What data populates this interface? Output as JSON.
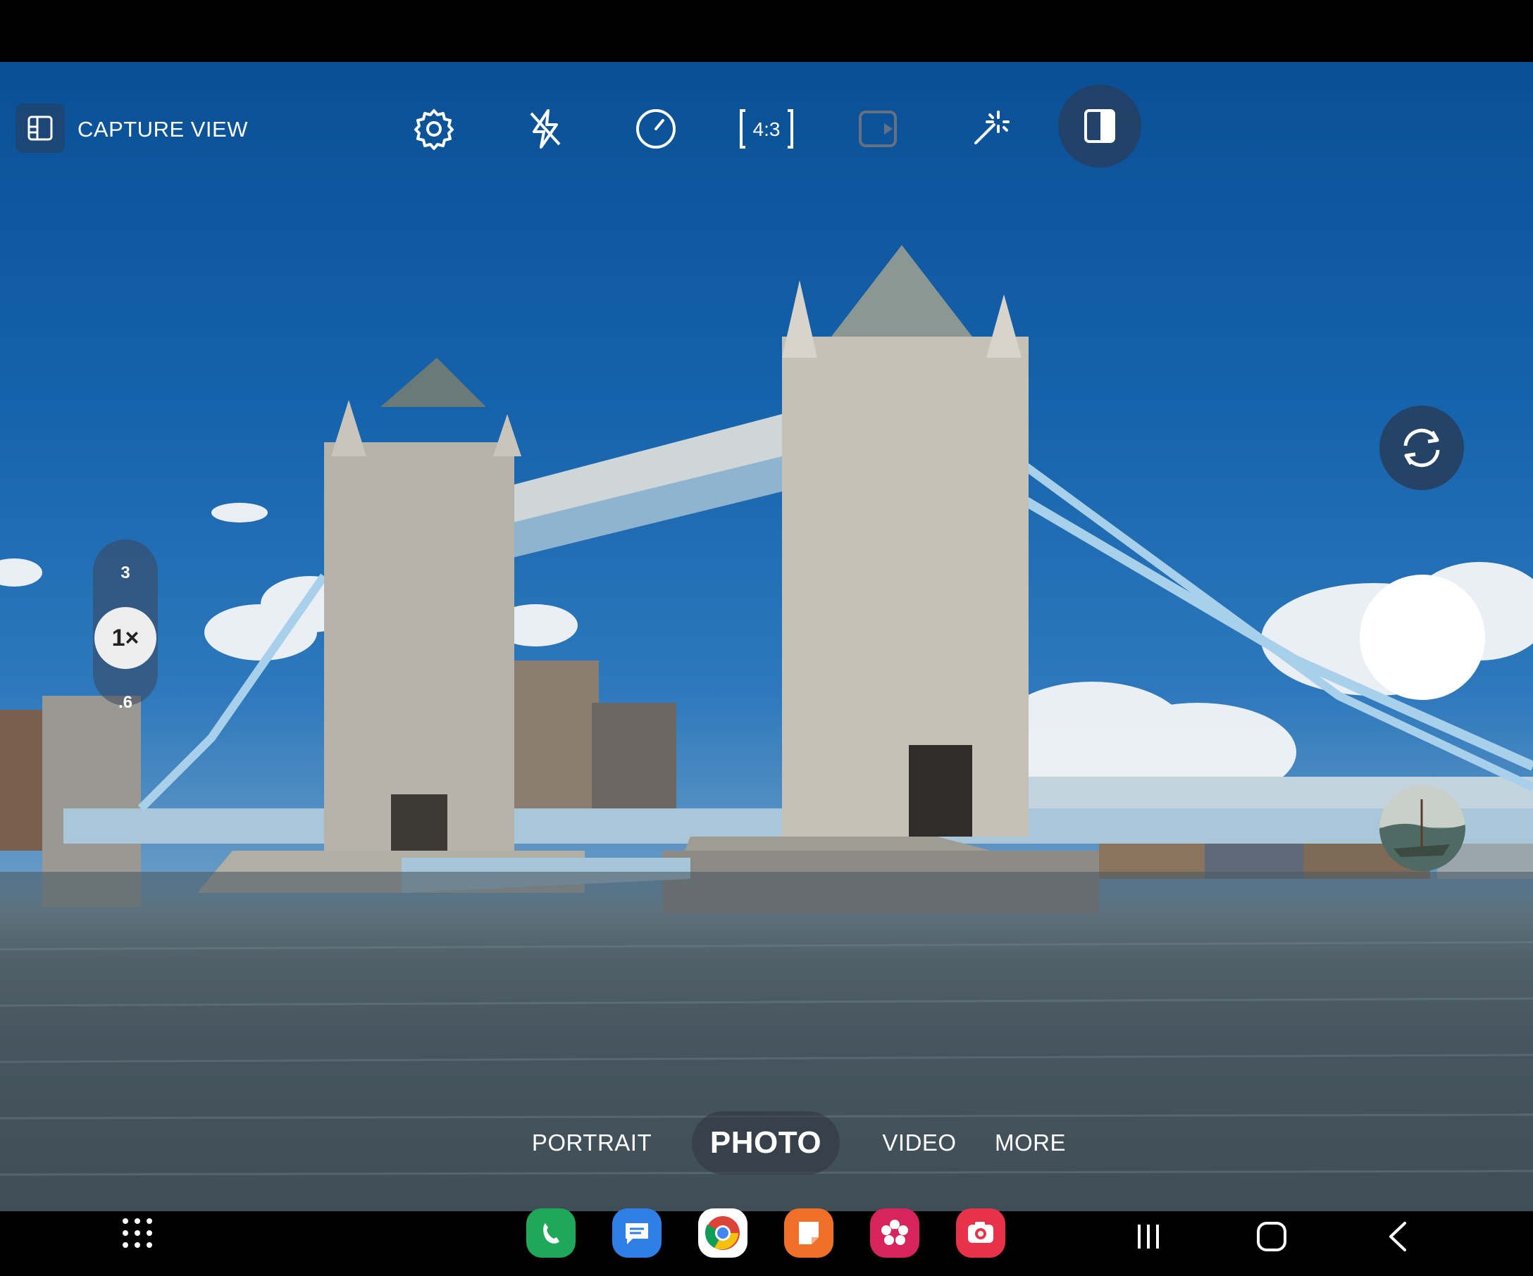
{
  "top_bar": {
    "capture_view_label": "CAPTURE VIEW",
    "icons": [
      "settings-icon",
      "flash-off-icon",
      "timer-icon",
      "aspect-ratio-icon",
      "motion-photo-icon",
      "filters-icon",
      "split-view-icon"
    ],
    "aspect_ratio_label": "4:3"
  },
  "zoom": {
    "level_3": "3",
    "level_1": "1×",
    "level_06": ".6"
  },
  "modes": {
    "portrait": "PORTRAIT",
    "photo": "PHOTO",
    "video": "VIDEO",
    "more": "MORE"
  },
  "dock": {
    "apps": [
      "apps-grid-icon",
      "phone-icon",
      "messages-icon",
      "chrome-icon",
      "notes-icon",
      "bixby-vision-icon",
      "camera-icon"
    ]
  },
  "nav": [
    "recents-icon",
    "home-icon",
    "back-icon"
  ],
  "colors": {
    "sky": "#1563ac",
    "water": "#3f4f59",
    "phone": "#1fa85a",
    "messages": "#2f7fe6",
    "notes": "#f0702a",
    "bixby": "#d8245c",
    "camera": "#e8324a"
  }
}
